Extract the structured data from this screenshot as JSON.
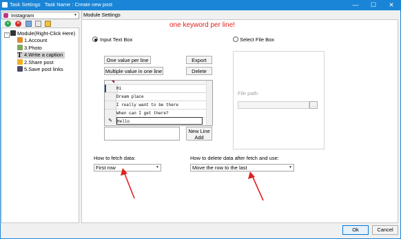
{
  "window": {
    "title": "Task Settings   Task Name : Create new post",
    "minimize": "—",
    "maximize": "☐",
    "close": "✕"
  },
  "left": {
    "dropdown_value": "Instagram",
    "tree_root": "Module(Right-Click Here)",
    "tree_items": [
      "1.Account",
      "3.Photo",
      "4.Write a caption",
      "2.Share post",
      "5.Save post links"
    ]
  },
  "panel": {
    "title": "Module Settings",
    "hint": "one keyword per line!",
    "input_text_label": "Input Text Box",
    "select_file_label": "Select File Box",
    "one_value_btn": "One value per line",
    "export_btn": "Export",
    "multi_value_btn": "Multiple value in one line",
    "delete_btn": "Delete",
    "rows": [
      "Hi",
      "Dream place",
      "I really want to be there",
      "When can I get there?",
      "Hello"
    ],
    "new_line_btn": "New Line Add",
    "file_path_label": "File path:",
    "browse_btn": "...",
    "fetch_label": "How to fetch data:",
    "fetch_value": "First row",
    "delete_label": "How to delete data after fetch and use:",
    "delete_value": "Move the row to the last"
  },
  "footer": {
    "ok": "Ok",
    "cancel": "Cancel"
  },
  "colors": {
    "titlebar": "#1a85d6",
    "hint": "#e02020",
    "arrow": "#e02020"
  }
}
